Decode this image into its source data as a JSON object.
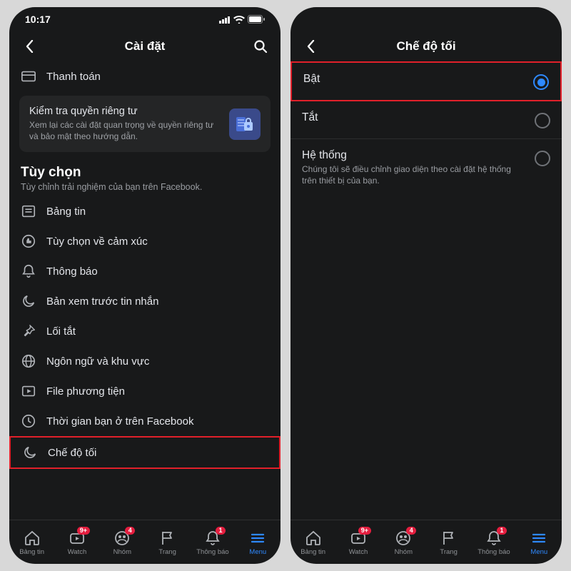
{
  "status": {
    "time": "10:17"
  },
  "left": {
    "title": "Cài đặt",
    "payments_row": "Thanh toán",
    "card": {
      "title": "Kiểm tra quyền riêng tư",
      "subtitle": "Xem lại các cài đặt quan trọng về quyền riêng tư và bảo mật theo hướng dẫn."
    },
    "section": {
      "title": "Tùy chọn",
      "subtitle": "Tùy chỉnh trải nghiệm của bạn trên Facebook."
    },
    "items": [
      {
        "label": "Bảng tin"
      },
      {
        "label": "Tùy chọn về cảm xúc"
      },
      {
        "label": "Thông báo"
      },
      {
        "label": "Bản xem trước tin nhắn"
      },
      {
        "label": "Lối tắt"
      },
      {
        "label": "Ngôn ngữ và khu vực"
      },
      {
        "label": "File phương tiện"
      },
      {
        "label": "Thời gian bạn ở trên Facebook"
      },
      {
        "label": "Chế độ tối"
      }
    ]
  },
  "right": {
    "title": "Chế độ tối",
    "options": [
      {
        "label": "Bật",
        "sub": ""
      },
      {
        "label": "Tắt",
        "sub": ""
      },
      {
        "label": "Hệ thống",
        "sub": "Chúng tôi sẽ điều chỉnh giao diện theo cài đặt hệ thống trên thiết bị của bạn."
      }
    ]
  },
  "tabs": [
    {
      "label": "Bảng tin",
      "badge": ""
    },
    {
      "label": "Watch",
      "badge": "9+"
    },
    {
      "label": "Nhóm",
      "badge": "4"
    },
    {
      "label": "Trang",
      "badge": ""
    },
    {
      "label": "Thông báo",
      "badge": "1"
    },
    {
      "label": "Menu",
      "badge": ""
    }
  ]
}
